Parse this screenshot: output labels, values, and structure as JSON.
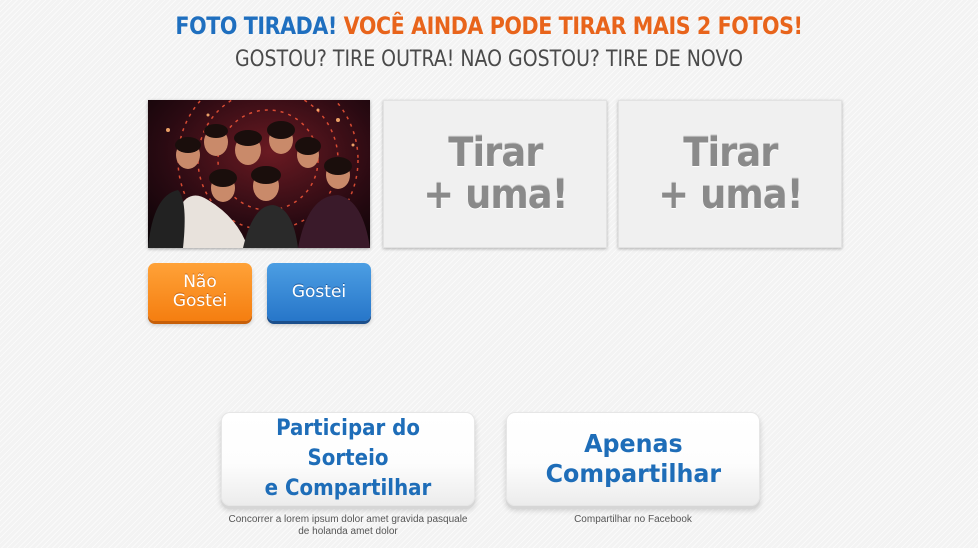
{
  "header": {
    "title_blue": "FOTO TIRADA!",
    "title_orange": "VOCÊ AINDA PODE TIRAR MAIS 2 FOTOS!",
    "subtitle": "GOSTOU? TIRE OUTRA! NAO GOSTOU? TIRE DE NOVO"
  },
  "photos": {
    "taken_photo": "group-party-photo",
    "slot_1_label": "Tirar\n+ uma!",
    "slot_2_label": "Tirar\n+ uma!"
  },
  "rating": {
    "dislike_label": "Não\nGostei",
    "like_label": "Gostei"
  },
  "share": {
    "participate_label": "Participar do Sorteio\ne Compartilhar",
    "participate_caption": "Concorrer a lorem ipsum dolor amet gravida pasquale\nde holanda amet dolor",
    "share_only_label": "Apenas\nCompartilhar",
    "share_only_caption": "Compartilhar no Facebook"
  },
  "colors": {
    "blue": "#1f6fbf",
    "orange": "#e8641b",
    "button_orange": "#f57e10",
    "button_blue": "#2776c9"
  }
}
